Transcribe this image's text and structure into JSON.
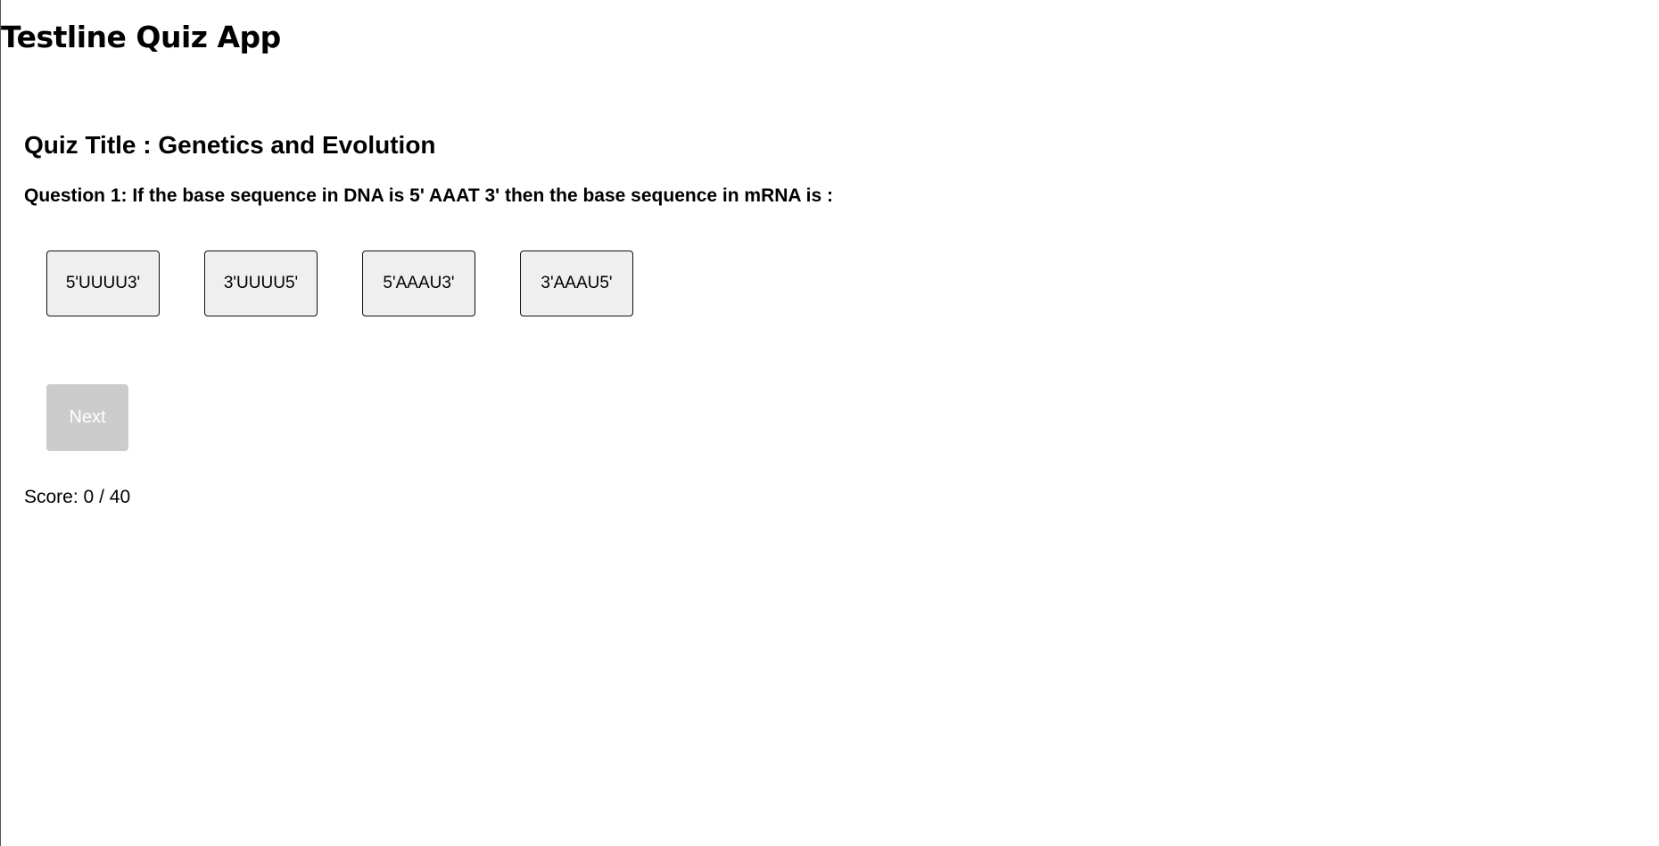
{
  "app": {
    "title": "Testline Quiz App"
  },
  "quiz": {
    "title": "Quiz Title : Genetics and Evolution",
    "question": "Question 1: If the base sequence in DNA is 5' AAAT 3' then the base sequence in mRNA is :",
    "options": [
      {
        "label": "5'UUUU3'"
      },
      {
        "label": "3'UUUU5'"
      },
      {
        "label": "5'AAAU3'"
      },
      {
        "label": "3'AAAU5'"
      }
    ],
    "next_label": "Next",
    "next_disabled": true
  },
  "score": {
    "label": "Score:",
    "current": "0",
    "separator": "/",
    "total": "40"
  },
  "colors": {
    "next_disabled_bg": "#cccccc",
    "option_bg": "#efefef"
  }
}
